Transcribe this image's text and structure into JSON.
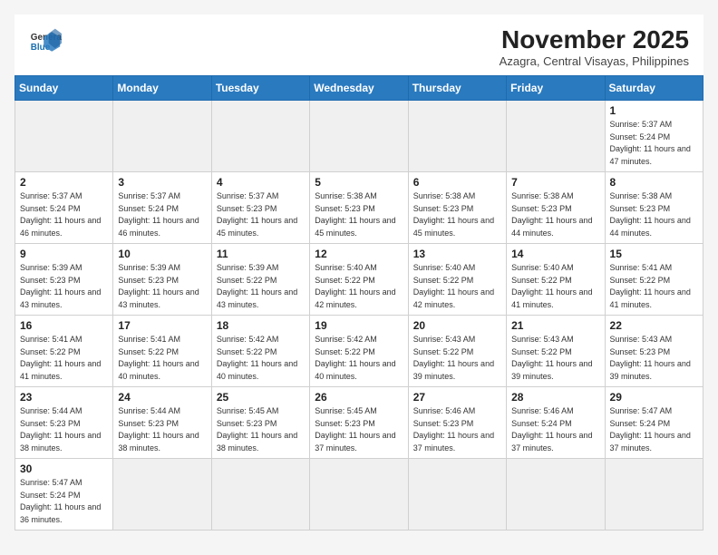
{
  "header": {
    "logo_line1": "General",
    "logo_line2": "Blue",
    "month_title": "November 2025",
    "location": "Azagra, Central Visayas, Philippines"
  },
  "weekdays": [
    "Sunday",
    "Monday",
    "Tuesday",
    "Wednesday",
    "Thursday",
    "Friday",
    "Saturday"
  ],
  "days": [
    {
      "date": "",
      "empty": true
    },
    {
      "date": "",
      "empty": true
    },
    {
      "date": "",
      "empty": true
    },
    {
      "date": "",
      "empty": true
    },
    {
      "date": "",
      "empty": true
    },
    {
      "date": "",
      "empty": true
    },
    {
      "date": "1",
      "sunrise": "5:37 AM",
      "sunset": "5:24 PM",
      "daylight": "11 hours and 47 minutes."
    },
    {
      "date": "2",
      "sunrise": "5:37 AM",
      "sunset": "5:24 PM",
      "daylight": "11 hours and 46 minutes."
    },
    {
      "date": "3",
      "sunrise": "5:37 AM",
      "sunset": "5:24 PM",
      "daylight": "11 hours and 46 minutes."
    },
    {
      "date": "4",
      "sunrise": "5:37 AM",
      "sunset": "5:23 PM",
      "daylight": "11 hours and 45 minutes."
    },
    {
      "date": "5",
      "sunrise": "5:38 AM",
      "sunset": "5:23 PM",
      "daylight": "11 hours and 45 minutes."
    },
    {
      "date": "6",
      "sunrise": "5:38 AM",
      "sunset": "5:23 PM",
      "daylight": "11 hours and 45 minutes."
    },
    {
      "date": "7",
      "sunrise": "5:38 AM",
      "sunset": "5:23 PM",
      "daylight": "11 hours and 44 minutes."
    },
    {
      "date": "8",
      "sunrise": "5:38 AM",
      "sunset": "5:23 PM",
      "daylight": "11 hours and 44 minutes."
    },
    {
      "date": "9",
      "sunrise": "5:39 AM",
      "sunset": "5:23 PM",
      "daylight": "11 hours and 43 minutes."
    },
    {
      "date": "10",
      "sunrise": "5:39 AM",
      "sunset": "5:23 PM",
      "daylight": "11 hours and 43 minutes."
    },
    {
      "date": "11",
      "sunrise": "5:39 AM",
      "sunset": "5:22 PM",
      "daylight": "11 hours and 43 minutes."
    },
    {
      "date": "12",
      "sunrise": "5:40 AM",
      "sunset": "5:22 PM",
      "daylight": "11 hours and 42 minutes."
    },
    {
      "date": "13",
      "sunrise": "5:40 AM",
      "sunset": "5:22 PM",
      "daylight": "11 hours and 42 minutes."
    },
    {
      "date": "14",
      "sunrise": "5:40 AM",
      "sunset": "5:22 PM",
      "daylight": "11 hours and 41 minutes."
    },
    {
      "date": "15",
      "sunrise": "5:41 AM",
      "sunset": "5:22 PM",
      "daylight": "11 hours and 41 minutes."
    },
    {
      "date": "16",
      "sunrise": "5:41 AM",
      "sunset": "5:22 PM",
      "daylight": "11 hours and 41 minutes."
    },
    {
      "date": "17",
      "sunrise": "5:41 AM",
      "sunset": "5:22 PM",
      "daylight": "11 hours and 40 minutes."
    },
    {
      "date": "18",
      "sunrise": "5:42 AM",
      "sunset": "5:22 PM",
      "daylight": "11 hours and 40 minutes."
    },
    {
      "date": "19",
      "sunrise": "5:42 AM",
      "sunset": "5:22 PM",
      "daylight": "11 hours and 40 minutes."
    },
    {
      "date": "20",
      "sunrise": "5:43 AM",
      "sunset": "5:22 PM",
      "daylight": "11 hours and 39 minutes."
    },
    {
      "date": "21",
      "sunrise": "5:43 AM",
      "sunset": "5:22 PM",
      "daylight": "11 hours and 39 minutes."
    },
    {
      "date": "22",
      "sunrise": "5:43 AM",
      "sunset": "5:23 PM",
      "daylight": "11 hours and 39 minutes."
    },
    {
      "date": "23",
      "sunrise": "5:44 AM",
      "sunset": "5:23 PM",
      "daylight": "11 hours and 38 minutes."
    },
    {
      "date": "24",
      "sunrise": "5:44 AM",
      "sunset": "5:23 PM",
      "daylight": "11 hours and 38 minutes."
    },
    {
      "date": "25",
      "sunrise": "5:45 AM",
      "sunset": "5:23 PM",
      "daylight": "11 hours and 38 minutes."
    },
    {
      "date": "26",
      "sunrise": "5:45 AM",
      "sunset": "5:23 PM",
      "daylight": "11 hours and 37 minutes."
    },
    {
      "date": "27",
      "sunrise": "5:46 AM",
      "sunset": "5:23 PM",
      "daylight": "11 hours and 37 minutes."
    },
    {
      "date": "28",
      "sunrise": "5:46 AM",
      "sunset": "5:24 PM",
      "daylight": "11 hours and 37 minutes."
    },
    {
      "date": "29",
      "sunrise": "5:47 AM",
      "sunset": "5:24 PM",
      "daylight": "11 hours and 37 minutes."
    },
    {
      "date": "30",
      "sunrise": "5:47 AM",
      "sunset": "5:24 PM",
      "daylight": "11 hours and 36 minutes."
    }
  ]
}
